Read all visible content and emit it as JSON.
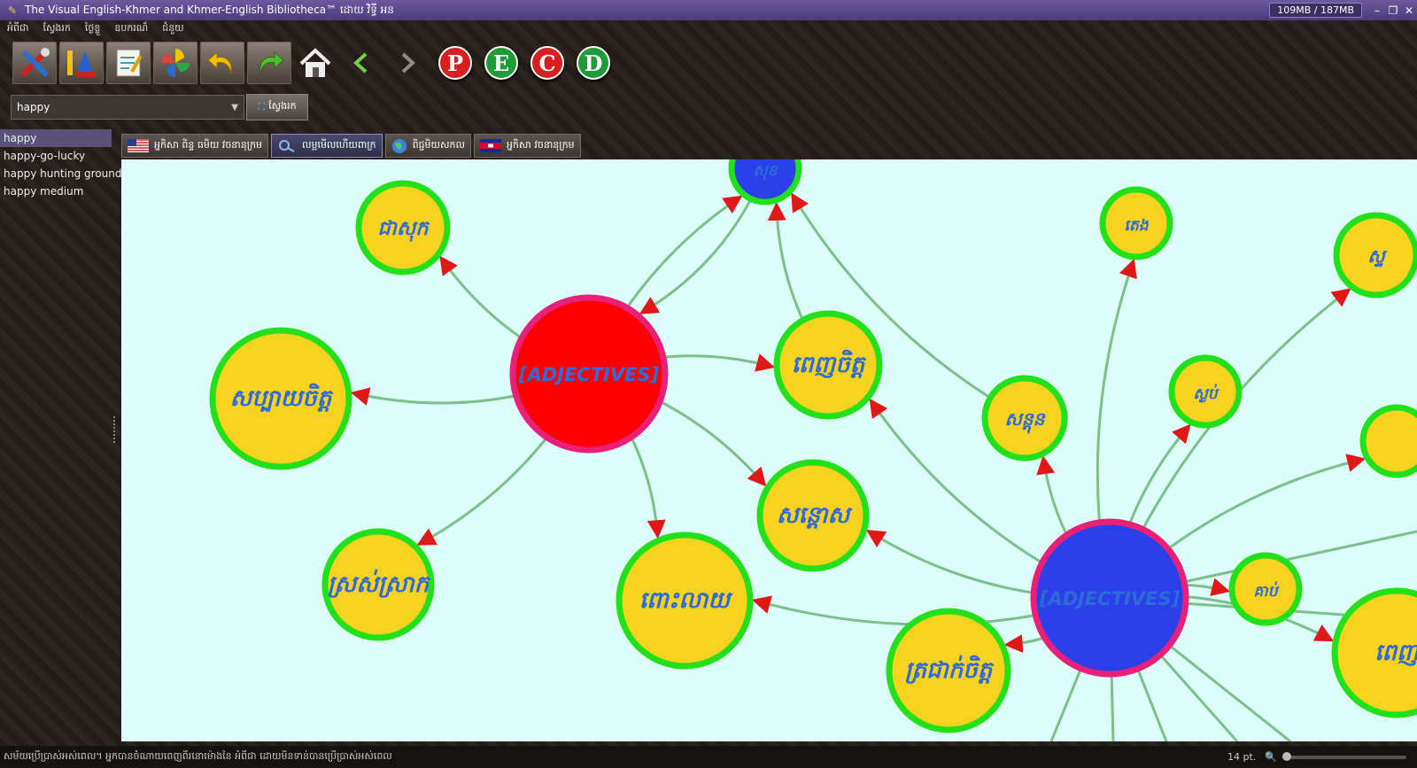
{
  "window": {
    "title": "The Visual English-Khmer and Khmer-English Bibliotheca™ ដោយ វិទ្ធី អន",
    "memory": "109MB / 187MB"
  },
  "menu": [
    "អំពីជា",
    "ស្វែងរក",
    "ថ្ងៃខ្លួ",
    "ឧបករណ៏",
    "ជំនួយ"
  ],
  "toolbar": {
    "buttons": [
      "tools-icon",
      "font-icon",
      "notes-icon",
      "pinwheel-icon",
      "undo-icon",
      "redo-icon"
    ],
    "home": "home-icon",
    "pecd": [
      "P",
      "E",
      "C",
      "D"
    ],
    "pecd_colors": [
      "#d81e1e",
      "#1e9b36",
      "#d81e1e",
      "#1e9b36"
    ]
  },
  "search": {
    "value": "happy",
    "find_label": "ស្វែងរក"
  },
  "wordlist": [
    "happy",
    "happy-go-lucky",
    "happy hunting ground",
    "happy medium"
  ],
  "tabs": [
    {
      "label": "អ្នកិសា ពិន្ទ ធមិយ វចនានុក្រម",
      "icon": "us-flag-icon"
    },
    {
      "label": "លម្អមើលហើយពាក្រ",
      "icon": "magnifier-icon"
    },
    {
      "label": "ពិជ្ជមិយសកល",
      "icon": "globe-icon"
    },
    {
      "label": "អ្នកិសា វចនានុក្រម",
      "icon": "kh-flag-icon"
    }
  ],
  "graph": {
    "hubs": [
      {
        "id": "h1",
        "label": "[ADJECTIVES]",
        "fill": "#ff0000"
      },
      {
        "id": "h2",
        "label": "[ADJECTIVES]",
        "fill": "#2a40e8"
      }
    ],
    "nodes": [
      {
        "id": "n_top",
        "label": "សុខ",
        "fill": "#2a40e8"
      },
      {
        "id": "n1",
        "label": "ជាសុក"
      },
      {
        "id": "n2",
        "label": "សប្បាយចិត្ត"
      },
      {
        "id": "n3",
        "label": "ស្រស់ស្រាក"
      },
      {
        "id": "n4",
        "label": "ពេញចិត្ត"
      },
      {
        "id": "n5",
        "label": "សន្តោស"
      },
      {
        "id": "n6",
        "label": "ពោះលាយ"
      },
      {
        "id": "n7",
        "label": "សន្តុន"
      },
      {
        "id": "n8",
        "label": "តេង"
      },
      {
        "id": "n9",
        "label": "ស្ងប់"
      },
      {
        "id": "n10",
        "label": "ស្ទ"
      },
      {
        "id": "n11",
        "label": "ត្រជាក់ចិត្ត"
      },
      {
        "id": "n12",
        "label": "គាប់"
      },
      {
        "id": "n13",
        "label": "ពេញ"
      },
      {
        "id": "n14",
        "label": ""
      }
    ]
  },
  "status": {
    "text": "សម័យប្រើប្រាស់អស់ពេល។ អ្នកបានចំណាយពេញពីរនោម៉ោងនៃ អំពីជា ដោយមិនទាន់បានប្រើប្រាស់អស់ពេល",
    "font_size": "14 pt."
  }
}
